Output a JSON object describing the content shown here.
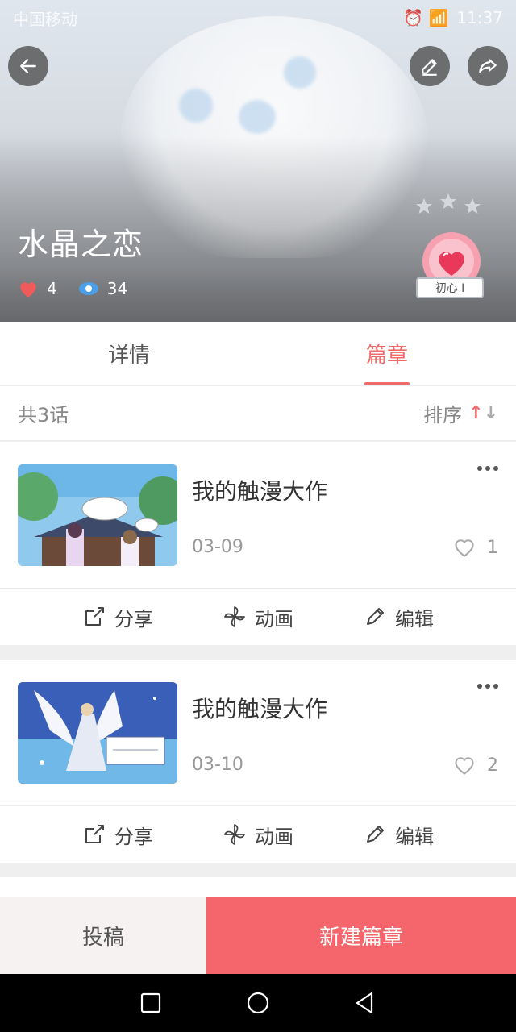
{
  "status_bar": {
    "carrier": "中国移动",
    "time": "11:37"
  },
  "header": {
    "title": "水晶之恋",
    "likes": "4",
    "views": "34",
    "badge_label": "初心 I"
  },
  "tabs": [
    {
      "label": "详情",
      "active": false
    },
    {
      "label": "篇章",
      "active": true
    }
  ],
  "list_header": {
    "count_text": "共3话",
    "sort_label": "排序"
  },
  "chapters": [
    {
      "title": "我的触漫大作",
      "date": "03-09",
      "likes": "1"
    },
    {
      "title": "我的触漫大作",
      "date": "03-10",
      "likes": "2"
    }
  ],
  "actions": {
    "share": "分享",
    "animation": "动画",
    "edit": "编辑"
  },
  "bottom": {
    "submit": "投稿",
    "new_chapter": "新建篇章"
  },
  "colors": {
    "accent": "#f06a6a",
    "primary_button": "#f4666b"
  }
}
